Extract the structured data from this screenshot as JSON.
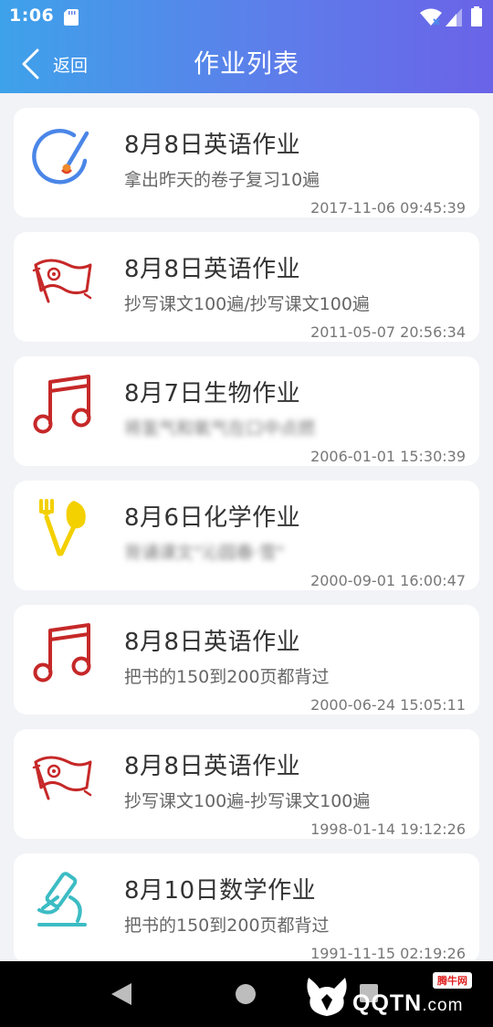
{
  "status_bar": {
    "time": "1:06"
  },
  "nav": {
    "back_label": "返回",
    "title": "作业列表"
  },
  "colors": {
    "header_start": "#3ea2ea",
    "header_end": "#6a63e8",
    "card_bg": "#ffffff",
    "page_bg": "#f2f3f7"
  },
  "homework": [
    {
      "icon": "palette-icon",
      "title": "8月8日英语作业",
      "desc": "拿出昨天的卷子复习10遍",
      "time": "2017-11-06 09:45:39"
    },
    {
      "icon": "flag-icon",
      "title": "8月8日英语作业",
      "desc": "抄写课文100遍/抄写课文100遍",
      "time": "2011-05-07 20:56:34"
    },
    {
      "icon": "music-note-icon",
      "title": "8月7日生物作业",
      "desc": "将氢气和氧气在口中点燃",
      "time": "2006-01-01 15:30:39"
    },
    {
      "icon": "shovel-fork-icon",
      "title": "8月6日化学作业",
      "desc": "背诵课文\"沁园春·雪\"",
      "time": "2000-09-01 16:00:47"
    },
    {
      "icon": "music-note-icon",
      "title": "8月8日英语作业",
      "desc": "把书的150到200页都背过",
      "time": "2000-06-24 15:05:11"
    },
    {
      "icon": "flag-icon",
      "title": "8月8日英语作业",
      "desc": "抄写课文100遍-抄写课文100遍",
      "time": "1998-01-14 19:12:26"
    },
    {
      "icon": "microscope-icon",
      "title": "8月10日数学作业",
      "desc": "把书的150到200页都背过",
      "time": "1991-11-15 02:19:26"
    }
  ],
  "watermark": {
    "text": "QQTN",
    "suffix": ".com",
    "badge": "腾牛网"
  }
}
